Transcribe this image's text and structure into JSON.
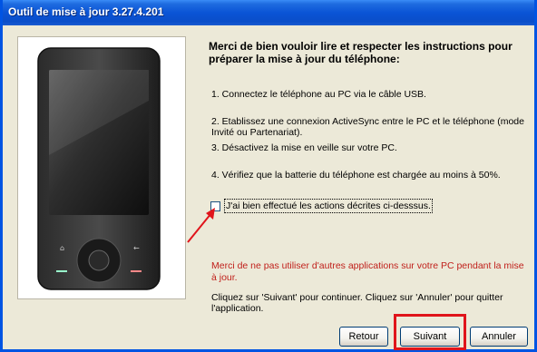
{
  "window": {
    "title": "Outil de mise à jour 3.27.4.201"
  },
  "instructions": {
    "heading": "Merci de bien vouloir lire et respecter les instructions pour préparer la mise à jour du téléphone:",
    "steps": [
      "1. Connectez le téléphone au PC via le câble USB.",
      "2. Etablissez une connexion ActiveSync entre le PC et le téléphone (mode Invité ou Partenariat).",
      "3. Désactivez la mise en veille sur votre PC.",
      "4. Vérifiez que la batterie du téléphone est chargée au moins à 50%."
    ]
  },
  "confirm_checkbox": {
    "label": "J'ai bien effectué les actions décrites ci-desssus.",
    "checked": false
  },
  "warning_text": "Merci de ne pas utiliser d'autres applications sur votre PC pendant la mise à jour.",
  "info_text": "Cliquez sur 'Suivant' pour continuer. Cliquez sur 'Annuler' pour quitter l'application.",
  "buttons": {
    "back": "Retour",
    "next": "Suivant",
    "cancel": "Annuler"
  },
  "colors": {
    "title_bar": "#0a54d6",
    "dialog_bg": "#ece9d8",
    "warning": "#c0201b",
    "highlight": "#e0141b"
  }
}
